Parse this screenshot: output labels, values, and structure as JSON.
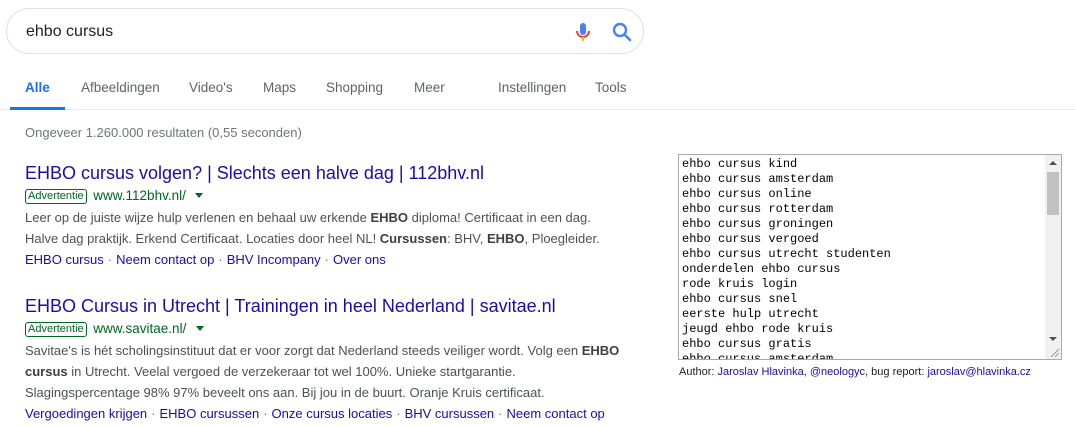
{
  "search": {
    "query": "ehbo cursus"
  },
  "tabs": [
    {
      "label": "Alle"
    },
    {
      "label": "Afbeeldingen"
    },
    {
      "label": "Video's"
    },
    {
      "label": "Maps"
    },
    {
      "label": "Shopping"
    },
    {
      "label": "Meer"
    },
    {
      "label": "Instellingen"
    },
    {
      "label": "Tools"
    }
  ],
  "stats": "Ongeveer 1.260.000 resultaten (0,55 seconden)",
  "results": [
    {
      "title": "EHBO cursus volgen? | Slechts een halve dag | 112bhv.nl",
      "badge": "Advertentie",
      "url": "www.112bhv.nl/",
      "snippet": [
        [
          "Leer op de juiste wijze hulp verlenen en behaal uw erkende ",
          "EHBO",
          " diploma! Certificaat in een dag."
        ],
        [
          "Halve dag praktijk. Erkend Certificaat. Locaties door heel NL! ",
          "Cursussen",
          ": BHV, ",
          "EHBO",
          ", Ploegleider."
        ]
      ],
      "sitelinks": [
        "EHBO cursus",
        "Neem contact op",
        "BHV Incompany",
        "Over ons"
      ]
    },
    {
      "title": "EHBO Cursus in Utrecht | Trainingen in heel Nederland | savitae.nl",
      "badge": "Advertentie",
      "url": "www.savitae.nl/",
      "snippet": [
        [
          "Savitae's is hét scholingsinstituut dat er voor zorgt dat Nederland steeds veiliger wordt. Volg een ",
          "EHBO"
        ],
        [
          "cursus",
          " in Utrecht. Veelal vergoed de verzekeraar tot wel 100%. Unieke startgarantie."
        ],
        [
          "Slagingspercentage 98% 97% beveelt ons aan. Bij jou in de buurt. Oranje Kruis certificaat."
        ]
      ],
      "sitelinks": [
        "Vergoedingen krijgen",
        "EHBO cursussen",
        "Onze cursus locaties",
        "BHV cursussen",
        "Neem contact op"
      ]
    }
  ],
  "suggestions": [
    "ehbo cursus kind",
    "ehbo cursus amsterdam",
    "ehbo cursus online",
    "ehbo cursus rotterdam",
    "ehbo cursus groningen",
    "ehbo cursus vergoed",
    "ehbo cursus utrecht studenten",
    "onderdelen ehbo cursus",
    "rode kruis login",
    "ehbo cursus snel",
    "eerste hulp utrecht",
    "jeugd ehbo rode kruis",
    "ehbo cursus gratis",
    "ehbo cursus amsterdam"
  ],
  "author": {
    "prefix": "Author: ",
    "name": "Jaroslav Hlavinka",
    "sep1": ", ",
    "handle": "@neologyc",
    "sep2": ", bug report: ",
    "email": "jaroslav@hlavinka.cz"
  },
  "colors": {
    "link": "#1a0dab",
    "accent": "#1a73e8",
    "ad_green": "#006621"
  }
}
